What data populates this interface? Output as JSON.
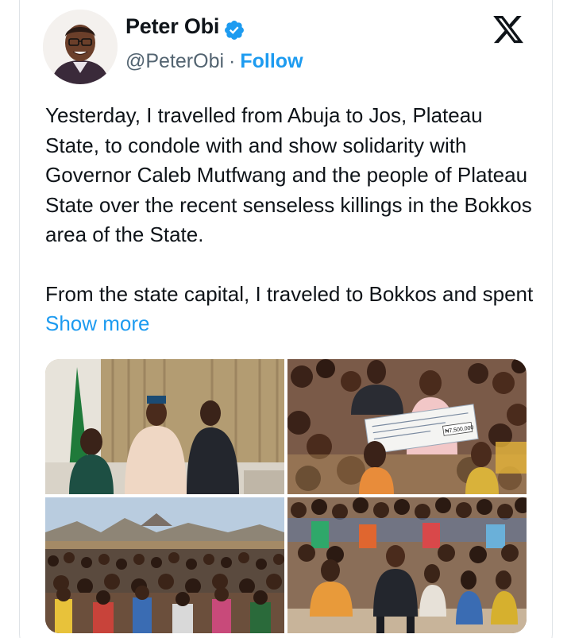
{
  "author": {
    "name": "Peter Obi",
    "handle": "@PeterObi",
    "separator": "·",
    "follow_label": "Follow"
  },
  "tweet": {
    "paragraph1": "Yesterday, I travelled from Abuja to Jos, Plateau State, to condole with and show solidarity with Governor Caleb Mutfwang and the people of Plateau State over the recent senseless killings in the Bokkos area of the State.",
    "paragraph2": "From the state capital, I traveled to Bokkos and spent",
    "show_more_label": "Show more"
  },
  "photos": {
    "cheque_amount": "₦7,500,000"
  },
  "icons": {
    "verified": "verified-badge-icon",
    "platform": "x-logo-icon"
  },
  "colors": {
    "accent": "#1d9bf0",
    "text": "#0f1419",
    "secondary": "#536471",
    "border": "#dfe3e7"
  }
}
